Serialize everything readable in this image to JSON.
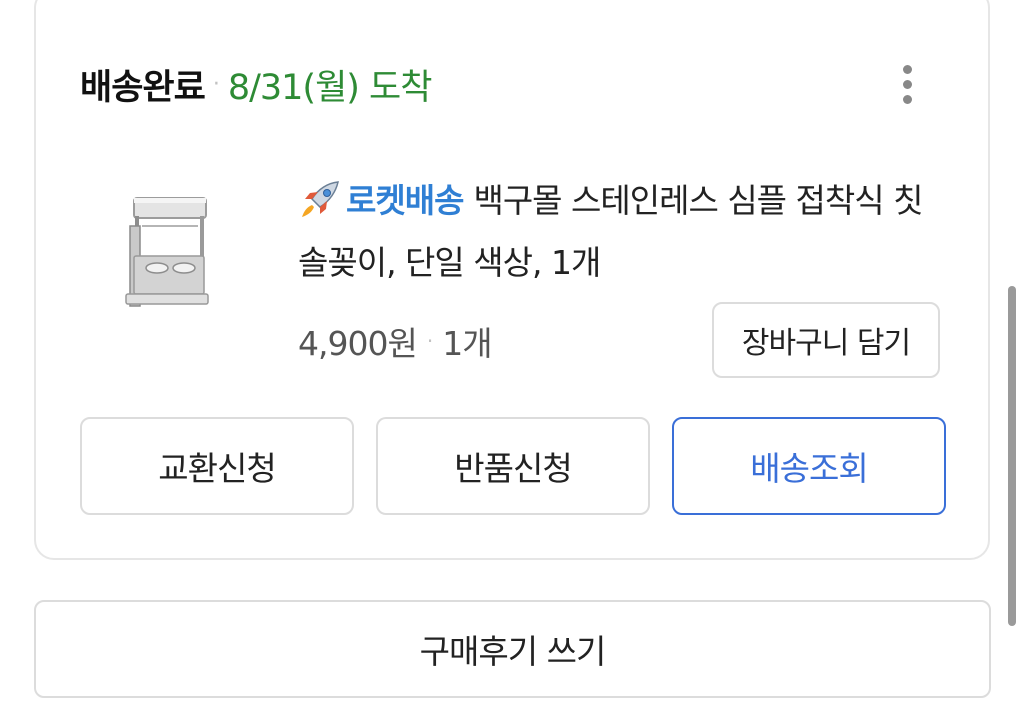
{
  "order": {
    "status": "배송완료",
    "separator": "·",
    "arrival": "8/31(월) 도착",
    "more_icon": "more-vertical-icon"
  },
  "product": {
    "image_icon": "toothbrush-holder-product-image",
    "rocket_icon": "rocket-icon",
    "rocket_label": "로켓배송",
    "name": "백구몰 스테인레스 심플 접착식 칫솔꽂이, 단일 색상, 1개",
    "price": "4,900원",
    "separator": "·",
    "quantity": "1개",
    "cart_button": "장바구니 담기"
  },
  "actions": {
    "exchange": "교환신청",
    "return": "반품신청",
    "tracking": "배송조회"
  },
  "review_button": "구매후기 쓰기",
  "colors": {
    "arrival_green": "#2e8b35",
    "rocket_blue": "#2f7fd4",
    "primary_blue": "#3a6fd8",
    "border_gray": "#dcdcdc"
  }
}
